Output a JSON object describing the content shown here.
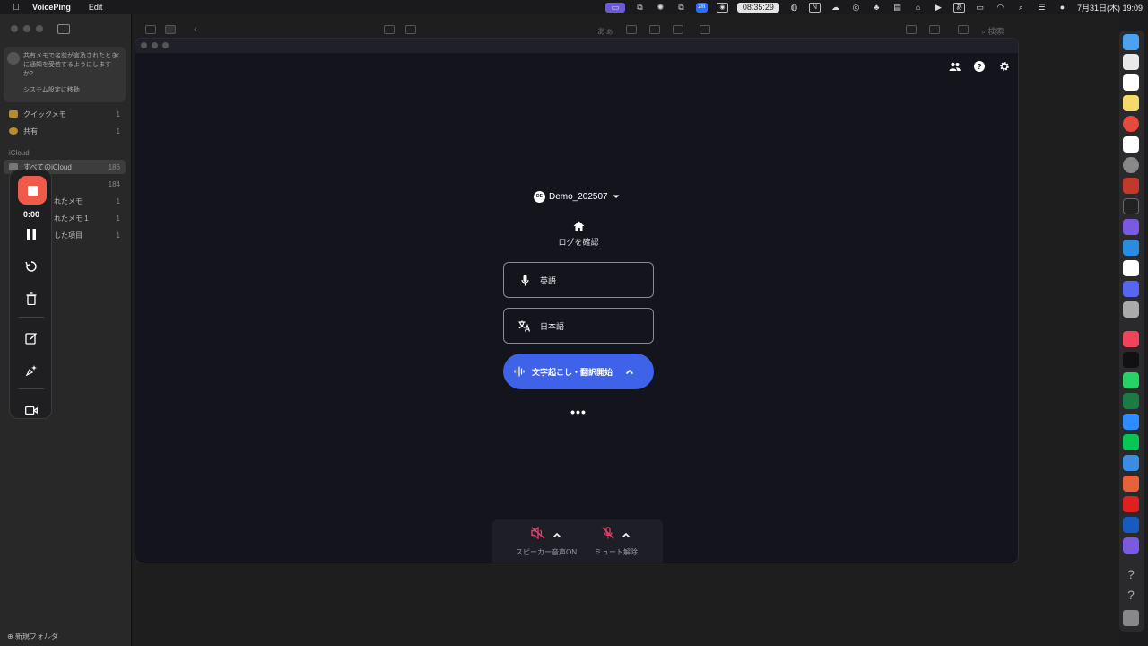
{
  "menubar": {
    "app_name": "VoicePing",
    "menu_edit": "Edit",
    "clock": "08:35:29",
    "date": "7月31日(木)  19:09"
  },
  "notes": {
    "notice_text": "共有メモで名前が言及されたときに通知を受信するようにしますか?",
    "notice_link": "システム設定に移動",
    "items": [
      {
        "label": "クイックメモ",
        "count": "1"
      },
      {
        "label": "共有",
        "count": "1"
      }
    ],
    "section": "iCloud",
    "icloud_items": [
      {
        "label": "すべてのiCloud",
        "count": "186"
      },
      {
        "label": "",
        "count": "184"
      },
      {
        "label": "れたメモ",
        "count": "1"
      },
      {
        "label": "れたメモ 1",
        "count": "1"
      },
      {
        "label": "した項目",
        "count": "1"
      }
    ],
    "new_folder": "新規フォルダ",
    "toolbar_text": "あぁ",
    "toolbar_search": "検索"
  },
  "recorder": {
    "time": "0:00"
  },
  "voiceping": {
    "session_logo": "DE",
    "session_name": "Demo_202507",
    "home_label": "ログを確認",
    "source_language": "英語",
    "target_language": "日本語",
    "start_button": "文字起こし・翻訳開始",
    "more": "•••",
    "speaker_label": "スピーカー音声ON",
    "mute_label": "ミュート解除"
  },
  "colors": {
    "accent_blue": "#3e63e8",
    "record_red": "#ef5b4b",
    "muted_pink": "#e0406a",
    "window_bg": "#14141d"
  }
}
